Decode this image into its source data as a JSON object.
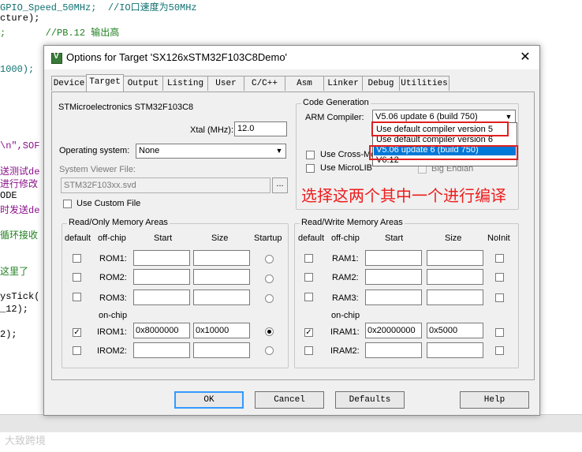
{
  "background_code": [
    {
      "text": "GPIO_Speed_50MHz;  //IO口速度为50MHz"
    },
    {
      "text": "cture);"
    },
    {
      "text": ";       //PB.12 输出高"
    },
    {
      "text": "1000);"
    },
    {
      "text": "\\n\",SOF"
    },
    {
      "text": "送测试de"
    },
    {
      "text": "进行修改"
    },
    {
      "text": "ODE"
    },
    {
      "text": "时发送de"
    },
    {
      "text": "循环接收"
    },
    {
      "text": "这里了"
    },
    {
      "text": "ysTick("
    },
    {
      "text": "_12);"
    },
    {
      "text": "2);"
    }
  ],
  "watermark": "大致跨境",
  "dialog": {
    "title": "Options for Target 'SX126xSTM32F103C8Demo'",
    "close": "✕",
    "tabs": [
      "Device",
      "Target",
      "Output",
      "Listing",
      "User",
      "C/C++",
      "Asm",
      "Linker",
      "Debug",
      "Utilities"
    ],
    "active_tab": "Target",
    "device_name": "STMicroelectronics STM32F103C8",
    "xtal_label": "Xtal (MHz):",
    "xtal_value": "12.0",
    "os_label": "Operating system:",
    "os_value": "None",
    "svf_label": "System Viewer File:",
    "svf_value": "STM32F103xx.svd",
    "browse": "...",
    "use_custom_file": "Use Custom File",
    "codegen": {
      "title": "Code Generation",
      "compiler_label": "ARM Compiler:",
      "compiler_value": "V5.06 update 6 (build 750)",
      "cross_module": "Use Cross-Mo",
      "microlib": "Use MicroLIB",
      "big_endian": "Big Endian",
      "options": [
        "Use default compiler version 5",
        "Use default compiler version 6",
        "V5.06 update 6 (build 750)",
        "V6.12"
      ],
      "selected_index": 2
    },
    "annotation": "选择这两个其中一个进行编译",
    "ro": {
      "title": "Read/Only Memory Areas",
      "headers": {
        "default": "default",
        "offchip": "off-chip",
        "start": "Start",
        "size": "Size",
        "extra": "Startup"
      },
      "onchip_label": "on-chip",
      "rows": [
        {
          "name": "ROM1:",
          "start": "",
          "size": "",
          "default": false,
          "selected": false
        },
        {
          "name": "ROM2:",
          "start": "",
          "size": "",
          "default": false,
          "selected": false
        },
        {
          "name": "ROM3:",
          "start": "",
          "size": "",
          "default": false,
          "selected": false
        },
        {
          "name": "IROM1:",
          "start": "0x8000000",
          "size": "0x10000",
          "default": true,
          "selected": true
        },
        {
          "name": "IROM2:",
          "start": "",
          "size": "",
          "default": false,
          "selected": false
        }
      ]
    },
    "rw": {
      "title": "Read/Write Memory Areas",
      "headers": {
        "default": "default",
        "offchip": "off-chip",
        "start": "Start",
        "size": "Size",
        "extra": "NoInit"
      },
      "onchip_label": "on-chip",
      "rows": [
        {
          "name": "RAM1:",
          "start": "",
          "size": "",
          "default": false,
          "noinit": false
        },
        {
          "name": "RAM2:",
          "start": "",
          "size": "",
          "default": false,
          "noinit": false
        },
        {
          "name": "RAM3:",
          "start": "",
          "size": "",
          "default": false,
          "noinit": false
        },
        {
          "name": "IRAM1:",
          "start": "0x20000000",
          "size": "0x5000",
          "default": true,
          "noinit": false
        },
        {
          "name": "IRAM2:",
          "start": "",
          "size": "",
          "default": false,
          "noinit": false
        }
      ]
    },
    "buttons": {
      "ok": "OK",
      "cancel": "Cancel",
      "defaults": "Defaults",
      "help": "Help"
    }
  }
}
